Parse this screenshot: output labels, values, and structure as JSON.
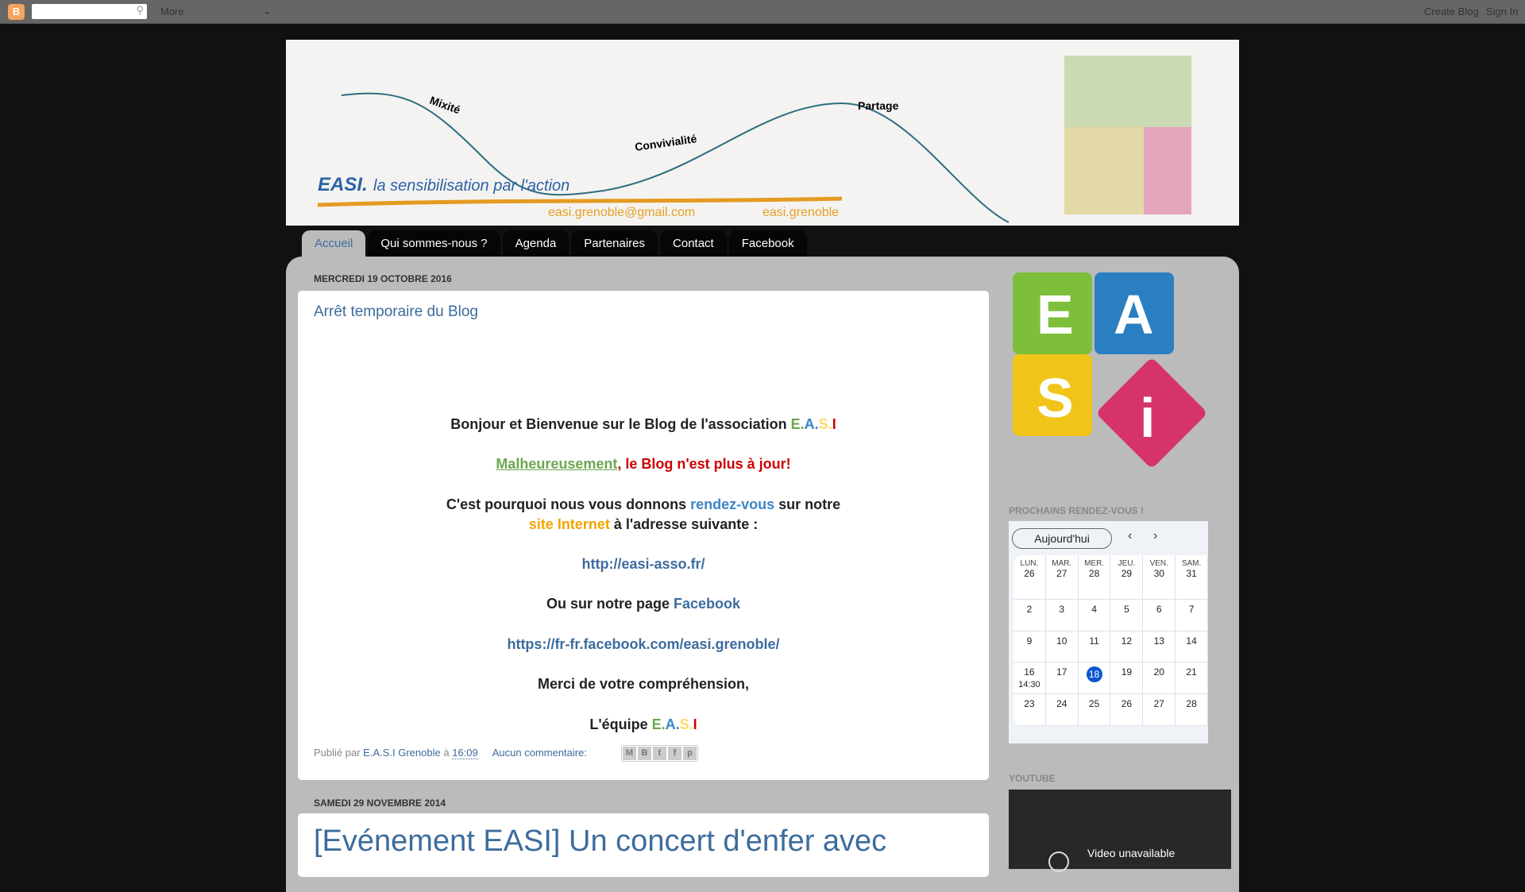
{
  "topbar": {
    "more": "More",
    "create_blog": "Create Blog",
    "sign_in": "Sign In"
  },
  "header": {
    "slogan_brand": "EASI.",
    "slogan": "la sensibilisation par l'action",
    "email": "easi.grenoble@gmail.com",
    "facebook": "easi.grenoble",
    "words": [
      "Mixité",
      "Convivialité",
      "Partage"
    ]
  },
  "tabs": [
    "Accueil",
    "Qui sommes-nous ?",
    "Agenda",
    "Partenaires",
    "Contact",
    "Facebook"
  ],
  "post1": {
    "date": "MERCREDI 19 OCTOBRE 2016",
    "title": "Arrêt temporaire du Blog",
    "l1": "Bonjour et Bienvenue sur le Blog de l'association ",
    "easi": [
      "E.",
      "A.",
      "S.",
      "I"
    ],
    "l2a": "Malheureusement",
    "l2b": ", le Blog n'est plus à jour!",
    "l3a": "C'est pourquoi nous vous donnons ",
    "l3b": "rendez-vous",
    "l3c": " sur notre",
    "l4a": "site Internet",
    "l4b": " à l'adresse suivante :",
    "url": "http://easi-asso.fr/",
    "l5a": "Ou sur notre page ",
    "l5b": "Facebook",
    "fburl": "https://fr-fr.facebook.com/easi.grenoble/",
    "l6": "Merci de votre compréhension,",
    "l7": "L'équipe ",
    "footer": {
      "by": "Publié par ",
      "author": "E.A.S.I Grenoble",
      "at": " à ",
      "time": "16:09",
      "comments": "Aucun commentaire:"
    }
  },
  "post2": {
    "date": "SAMEDI 29 NOVEMBRE 2014",
    "title": "[Evénement EASI] Un concert d'enfer avec"
  },
  "sidebar": {
    "logo": [
      "E",
      "A",
      "S",
      "i"
    ],
    "agenda_title": "PROCHAINS RENDEZ-VOUS !",
    "youtube_title": "YOUTUBE",
    "video_msg": "Video unavailable"
  },
  "calendar": {
    "today": "Aujourd'hui",
    "days": [
      "LUN.",
      "MAR.",
      "MER.",
      "JEU.",
      "VEN.",
      "SAM."
    ],
    "weeks": [
      [
        "26",
        "27",
        "28",
        "29",
        "30",
        "31"
      ],
      [
        "2",
        "3",
        "4",
        "5",
        "6",
        "7"
      ],
      [
        "9",
        "10",
        "11",
        "12",
        "13",
        "14"
      ],
      [
        "16",
        "17",
        "18",
        "19",
        "20",
        "21"
      ],
      [
        "23",
        "24",
        "25",
        "26",
        "27",
        "28"
      ]
    ],
    "current": "18",
    "event": {
      "day": "16",
      "time": "14:30"
    }
  }
}
